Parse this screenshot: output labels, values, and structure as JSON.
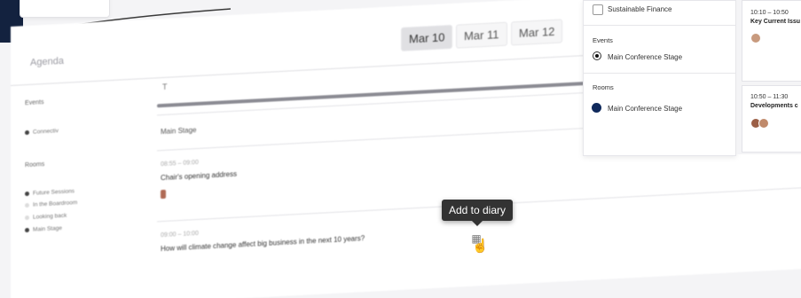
{
  "agenda": {
    "title": "Agenda",
    "days": [
      "Mar 10",
      "Mar 11",
      "Mar 12"
    ],
    "text_field": "T",
    "sidebar": {
      "events_label": "Events",
      "events_items": [
        "Connectiv"
      ],
      "rooms_label": "Rooms",
      "rooms_items": [
        "Future Sessions",
        "In the Boardroom",
        "Looking back",
        "Main Stage"
      ]
    },
    "stage_label": "Main Stage",
    "sessions": [
      {
        "time": "08:55 – 09:00",
        "title": "Chair's opening address"
      },
      {
        "time": "09:00 – 10:00",
        "title": "How will climate change affect big business in the next 10 years?"
      }
    ],
    "tooltip": "Add to diary",
    "diary_icon": "calendar-icon",
    "cursor_icon": "hand-pointer-icon"
  },
  "filter": {
    "checkbox_label": "Sustainable Finance",
    "events_label": "Events",
    "events_option": "Main Conference Stage",
    "rooms_label": "Rooms",
    "rooms_option": "Main Conference Stage",
    "room_color": "#102a5c"
  },
  "cards": [
    {
      "time": "10:10 – 10:50",
      "title": "Key Current Issu"
    },
    {
      "time": "10:50 – 11:30",
      "title": "Developments c"
    }
  ]
}
